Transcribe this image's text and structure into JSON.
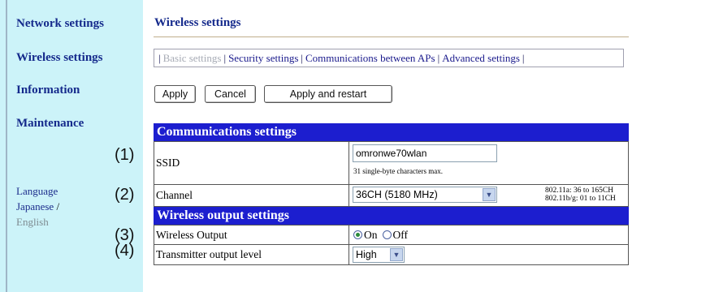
{
  "sidebar": {
    "items": [
      {
        "label": "Network settings"
      },
      {
        "label": "Wireless settings"
      },
      {
        "label": "Information"
      },
      {
        "label": "Maintenance"
      }
    ],
    "language": {
      "heading": "Language",
      "japanese": "Japanese",
      "separator": " /",
      "english": "English"
    }
  },
  "markers": [
    "(1)",
    "(2)",
    "(3)",
    "(4)"
  ],
  "main": {
    "title": "Wireless settings",
    "subtabs": [
      {
        "label": "Basic settings",
        "current": true
      },
      {
        "label": "Security settings",
        "current": false
      },
      {
        "label": "Communications between APs",
        "current": false
      },
      {
        "label": "Advanced settings",
        "current": false
      }
    ],
    "subtab_separator": "|",
    "buttons": {
      "apply": "Apply",
      "cancel": "Cancel",
      "apply_restart": "Apply and restart"
    },
    "sections": {
      "communications": {
        "title": "Communications settings",
        "ssid": {
          "label": "SSID",
          "value": "omronwe70wlan",
          "hint": "31 single-byte characters max."
        },
        "channel": {
          "label": "Channel",
          "selected": "36CH (5180 MHz)",
          "note_line1": "802.11a: 36 to 165CH",
          "note_line2": "802.11b/g: 01 to 11CH"
        }
      },
      "wireless_output": {
        "title": "Wireless output settings",
        "output": {
          "label": "Wireless Output",
          "on": "On",
          "off": "Off",
          "selected": "On"
        },
        "tx_level": {
          "label": "Transmitter output level",
          "selected": "High"
        }
      }
    }
  },
  "colors": {
    "sidebar_bg": "#ccf3f9",
    "link": "#152a8c",
    "section_header": "#1c1ecf",
    "current_tab": "#a7abb5"
  }
}
